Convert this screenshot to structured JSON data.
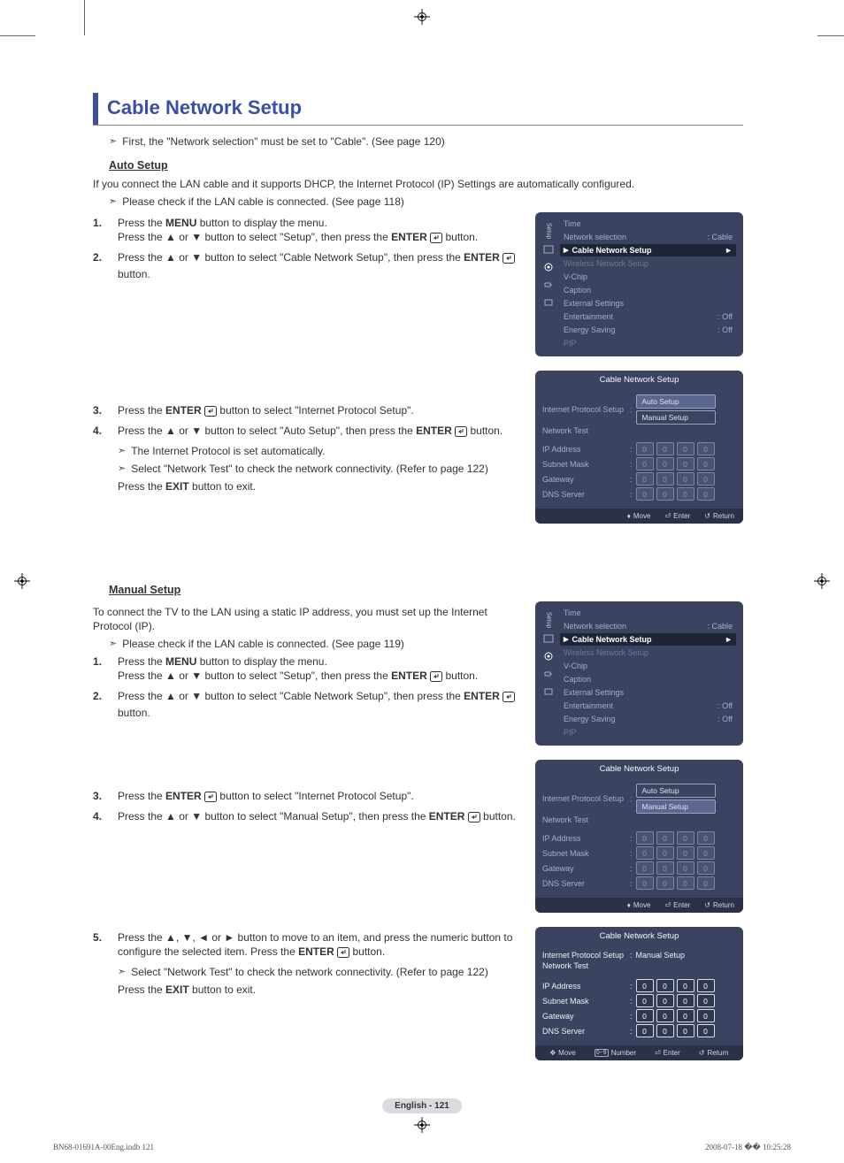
{
  "title": "Cable Network Setup",
  "intro_note": "First, the \"Network selection\" must be set to \"Cable\". (See page 120)",
  "auto_setup": {
    "heading": "Auto Setup",
    "lead": "If you connect the LAN cable and it supports DHCP, the Internet Protocol (IP) Settings are automatically configured.",
    "check_note": "Please check if the LAN cable is connected. (See page 118)",
    "step1a": "Press the ",
    "step1a_b": "MENU",
    "step1a_tail": " button to display the menu.",
    "step1b": "Press the ▲ or ▼ button to select \"Setup\", then press the ",
    "step1b_b": "ENTER",
    "step1b_tail": " button.",
    "step2a": "Press the ▲ or ▼ button to select \"Cable Network Setup\", then press the ",
    "step2a_b": "ENTER",
    "step2a_tail": " button.",
    "step3": "Press the ",
    "step3_b": "ENTER",
    "step3_tail": " button to select \"Internet Protocol Setup\".",
    "step4a": "Press the ▲ or ▼ button to select \"Auto Setup\", then press the ",
    "step4a_b": "ENTER",
    "step4a_tail": " button.",
    "step4_note1": "The Internet Protocol is set automatically.",
    "step4_note2": "Select \"Network Test\" to check the network connectivity. (Refer to page 122)",
    "step4_tail": "Press the ",
    "step4_tail_b": "EXIT",
    "step4_tail2": " button to exit."
  },
  "manual_setup": {
    "heading": "Manual Setup",
    "lead": "To connect the TV to the LAN using a static IP address, you must set up the Internet Protocol (IP).",
    "check_note": "Please check if the LAN cable is connected. (See page 119)",
    "step1a": "Press the ",
    "step1a_b": "MENU",
    "step1a_tail": " button to display the menu.",
    "step1b": "Press the ▲ or ▼ button to select \"Setup\", then press the ",
    "step1b_b": "ENTER",
    "step1b_tail": " button.",
    "step2a": "Press the ▲ or ▼ button to select \"Cable Network Setup\", then press the ",
    "step2a_b": "ENTER",
    "step2a_tail": " button.",
    "step3": "Press the ",
    "step3_b": "ENTER",
    "step3_tail": " button to select \"Internet Protocol Setup\".",
    "step4a": "Press the ▲ or ▼ button to select \"Manual Setup\", then press the ",
    "step4a_b": "ENTER",
    "step4a_tail": " button.",
    "step5a": "Press the ▲, ▼, ◄ or ► button to move to an item, and press the numeric button to configure the selected item. Press the ",
    "step5a_b": "ENTER",
    "step5a_tail": " button.",
    "step5_note": "Select \"Network Test\" to check the network connectivity. (Refer to page 122)",
    "step5_tail": "Press the ",
    "step5_tail_b": "EXIT",
    "step5_tail2": " button to exit."
  },
  "osd_setup": {
    "sidebar_label": "Setup",
    "items": [
      {
        "label": "Time",
        "value": ""
      },
      {
        "label": "Network selection",
        "value": ": Cable"
      },
      {
        "label": "Cable Network Setup",
        "value": "►",
        "hi": true
      },
      {
        "label": "Wireless Network Setup",
        "value": "",
        "dim": true
      },
      {
        "label": "V-Chip",
        "value": ""
      },
      {
        "label": "Caption",
        "value": ""
      },
      {
        "label": "External Settings",
        "value": ""
      },
      {
        "label": "Entertainment",
        "value": ": Off"
      },
      {
        "label": "Energy Saving",
        "value": ": Off"
      },
      {
        "label": "PIP",
        "value": "",
        "dim": true
      }
    ]
  },
  "osd_cable": {
    "title": "Cable Network Setup",
    "rows": [
      {
        "label": "Internet Protocol Setup",
        "colon": ":"
      },
      {
        "label": "Network Test"
      }
    ],
    "dd_auto": "Auto Setup",
    "dd_manual": "Manual Setup",
    "ip_rows": [
      "IP Address",
      "Subnet Mask",
      "Gateway",
      "DNS Server"
    ],
    "ip_val": "0"
  },
  "osd_cable_manual_value": "Manual Setup",
  "footer3": {
    "move": "Move",
    "enter": "Enter",
    "return": "Return"
  },
  "footer4": {
    "move": "Move",
    "number": "Number",
    "enter": "Enter",
    "return": "Return"
  },
  "footer_icons": {
    "updown": "▲▼",
    "arrows": "◄ ►",
    "numrange": "0~9",
    "enter": "⏎",
    "return": "↩"
  },
  "page_pill": "English - 121",
  "doc_footer_left": "BN68-01691A-00Eng.indb   121",
  "doc_footer_right": "2008-07-18   �� 10:25:28"
}
